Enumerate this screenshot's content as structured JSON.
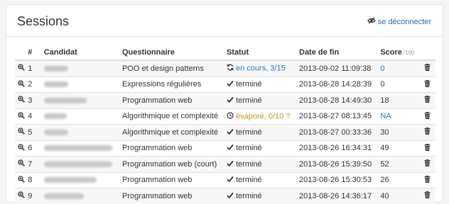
{
  "header": {
    "title": "Sessions",
    "logout_label": "se déconnecter"
  },
  "table": {
    "columns": {
      "num": "#",
      "candidat": "Candidat",
      "questionnaire": "Questionnaire",
      "statut": "Statut",
      "date_fin": "Date de fin",
      "score": "Score",
      "score_sub": "/100"
    },
    "rows": [
      {
        "num": "1",
        "candidat_width": 34,
        "questionnaire": "POO et design patterns",
        "status_icon": "refresh-icon",
        "status": "en cours, 3/15",
        "status_type": "running",
        "date": "2013-09-02 11:09:38",
        "score": "0",
        "score_link": true
      },
      {
        "num": "2",
        "candidat_width": 34,
        "questionnaire": "Expressions régulières",
        "status_icon": "check-icon",
        "status": "terminé",
        "status_type": "done",
        "date": "2013-08-28 14:28:39",
        "score": "0",
        "score_link": false
      },
      {
        "num": "3",
        "candidat_width": 60,
        "questionnaire": "Programmation web",
        "status_icon": "check-icon",
        "status": "terminé",
        "status_type": "done",
        "date": "2013-08-28 14:49:30",
        "score": "18",
        "score_link": false
      },
      {
        "num": "4",
        "candidat_width": 32,
        "questionnaire": "Algorithmique et complexité",
        "status_icon": "clock-icon",
        "status": "évaporé, 0/10 ?",
        "status_type": "evaporated",
        "date": "2013-08-27 08:13:45",
        "score": "NA",
        "score_link": true
      },
      {
        "num": "5",
        "candidat_width": 34,
        "questionnaire": "Algorithmique et complexité",
        "status_icon": "check-icon",
        "status": "terminé",
        "status_type": "done",
        "date": "2013-08-27 00:33:36",
        "score": "30",
        "score_link": false
      },
      {
        "num": "6",
        "candidat_width": 96,
        "questionnaire": "Programmation web",
        "status_icon": "check-icon",
        "status": "terminé",
        "status_type": "done",
        "date": "2013-08-26 16:34:31",
        "score": "49",
        "score_link": false
      },
      {
        "num": "7",
        "candidat_width": 96,
        "questionnaire": "Programmation web (court)",
        "status_icon": "check-icon",
        "status": "terminé",
        "status_type": "done",
        "date": "2013-08-26 15:39:50",
        "score": "52",
        "score_link": false
      },
      {
        "num": "8",
        "candidat_width": 74,
        "questionnaire": "Programmation web",
        "status_icon": "check-icon",
        "status": "terminé",
        "status_type": "done",
        "date": "2013-08-26 15:30:53",
        "score": "26",
        "score_link": false
      },
      {
        "num": "9",
        "candidat_width": 56,
        "questionnaire": "Programmation web",
        "status_icon": "check-icon",
        "status": "terminé",
        "status_type": "done",
        "date": "2013-08-26 14:36:17",
        "score": "40",
        "score_link": false
      }
    ]
  },
  "colors": {
    "link": "#2a7ab8",
    "warning": "#c49525",
    "text": "#333333"
  }
}
